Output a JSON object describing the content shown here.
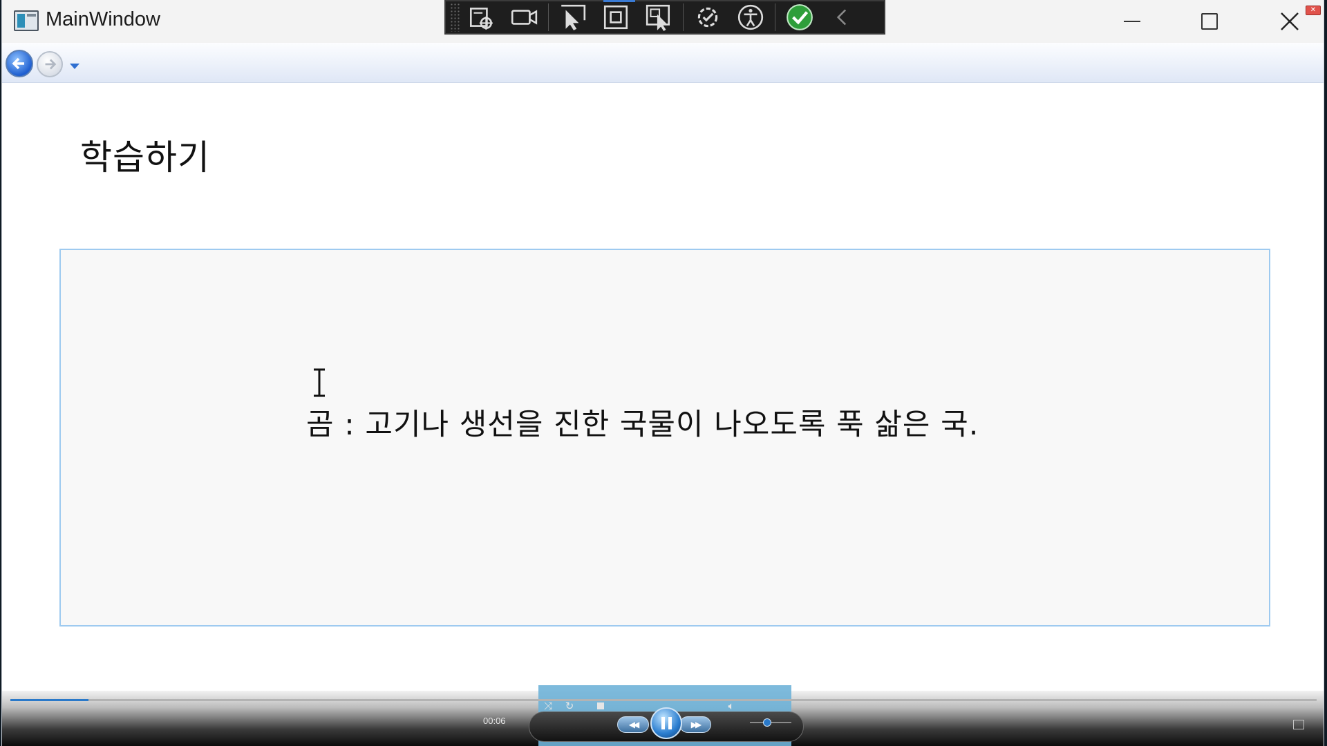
{
  "window": {
    "title": "MainWindow"
  },
  "debug_toolbar": {
    "icons": [
      "select-element-icon",
      "record-icon",
      "pointer-select-icon",
      "layout-adorner-icon",
      "track-focus-icon",
      "hot-reload-icon",
      "accessibility-icon",
      "binding-check-icon",
      "collapse-icon"
    ]
  },
  "nav": {
    "back_icon": "back-arrow-icon",
    "forward_icon": "forward-arrow-icon"
  },
  "content": {
    "page_title": "학습하기",
    "definition": "곰 : 고기나 생선을 진한 국물이 나오도록 푹 삶은 국."
  },
  "player": {
    "time": "00:06",
    "progress": 0.06,
    "volume": 0.42,
    "accent_color": "#2a79c9"
  }
}
